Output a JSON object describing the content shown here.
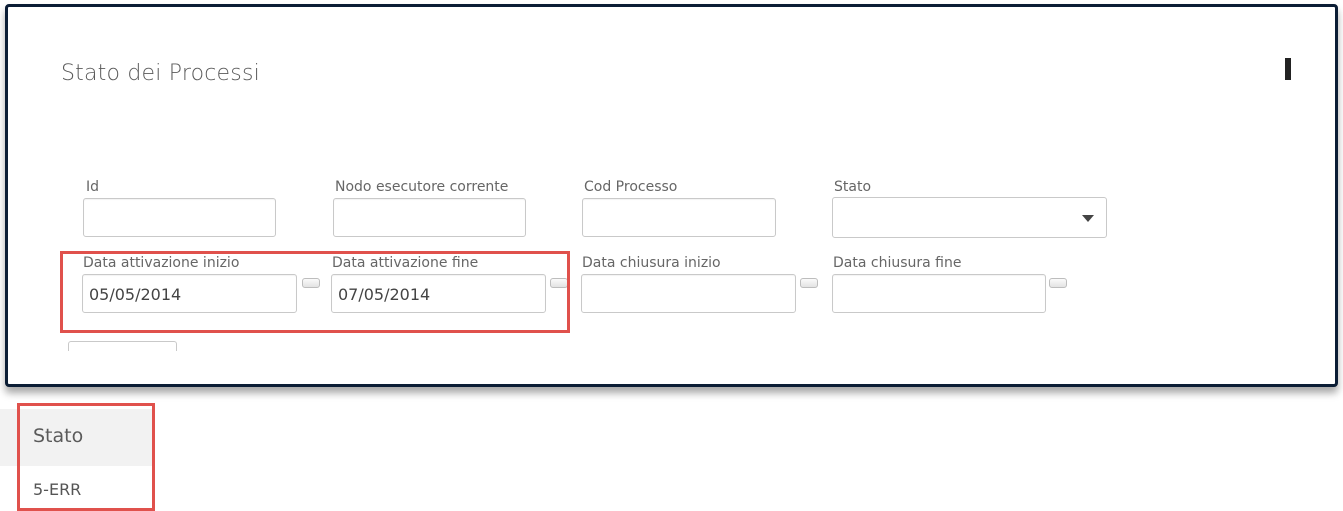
{
  "panel": {
    "title": "Stato dei Processi"
  },
  "filters": {
    "id": {
      "label": "Id",
      "value": ""
    },
    "nodo": {
      "label": "Nodo esecutore corrente",
      "value": ""
    },
    "cod_processo": {
      "label": "Cod Processo",
      "value": ""
    },
    "stato": {
      "label": "Stato",
      "value": ""
    },
    "data_attivazione_inizio": {
      "label": "Data attivazione inizio",
      "value": "05/05/2014"
    },
    "data_attivazione_fine": {
      "label": "Data attivazione fine",
      "value": "07/05/2014"
    },
    "data_chiusura_inizio": {
      "label": "Data chiusura inizio",
      "value": ""
    },
    "data_chiusura_fine": {
      "label": "Data chiusura fine",
      "value": ""
    }
  },
  "results": {
    "column_header": "Stato",
    "rows": [
      "5-ERR"
    ]
  },
  "colors": {
    "highlight": "#e0514c",
    "panel_border": "#0b1d35"
  },
  "icons": {
    "dropdown": "chevron-down-icon",
    "date_picker": "calendar-icon"
  }
}
